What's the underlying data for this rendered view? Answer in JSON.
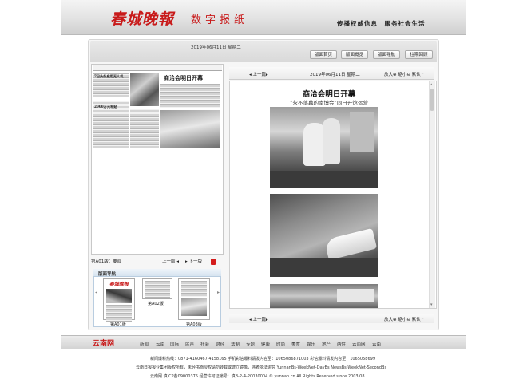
{
  "header": {
    "logo_text": "春城晚報",
    "subtitle": "数字报纸",
    "slogan": "传播权威信息　服务社会生活"
  },
  "toolbar": {
    "date_text": "2019年06月11日 星期二",
    "buttons": [
      "版面首页",
      "版面概览",
      "版面导航",
      "往期回顾"
    ]
  },
  "left_page": {
    "thumb_headline": "商洽会明日开幕",
    "thumb_small_headline_1": "7日头条启用无人机",
    "thumb_small_headline_2": "2000万元补贴",
    "page_label": "第A01版：要闻",
    "prev_label": "上一版",
    "next_label": "下一版",
    "pdf_icon": "pdf-icon"
  },
  "nav_box": {
    "title": "版面导航",
    "thumbnails": [
      {
        "label": "第A01版",
        "headline": "春城晚报"
      },
      {
        "label": "第A02版",
        "headline": ""
      },
      {
        "label": "第A03版",
        "headline": ""
      }
    ]
  },
  "article_nav": {
    "prev_label": "上一篇",
    "date_text": "2019年06月11日 星期二",
    "zoom_in": "放大",
    "zoom_out": "缩小",
    "default": "默认"
  },
  "article": {
    "title": "商洽会明日开幕",
    "subtitle": "“永不落幕的南博会”同日开馆运营"
  },
  "article_bottom_nav": {
    "prev_label": "上一篇",
    "zoom_in": "放大",
    "zoom_out": "缩小",
    "default": "默认"
  },
  "footer": {
    "logo_text": "云南网",
    "links": [
      "新闻",
      "云南",
      "国际",
      "民声",
      "社会",
      "财经",
      "法制",
      "专题",
      "健康",
      "时尚",
      "美食",
      "娱乐",
      "地产",
      "两性",
      "云南网",
      "云南"
    ],
    "line1": "新闻爆料热线：0871-4160467 4158165 手机彩信爆料请发内容至：1065086871003 彩信爆料请发内容至：1065058699",
    "line2": "云南日报报业集团版权所有，未经书面授权请勿转载或建立镜像，违者依法追究 YunnanBs-WeekNet-DayBs NewsBs-WeekNet-SecondBs",
    "line3": "云南网  滇ICP备09000375    经营许可证编号：滇B-2-4-20030004 © yunnan.cn All Rights Reserved since 2003.08"
  }
}
